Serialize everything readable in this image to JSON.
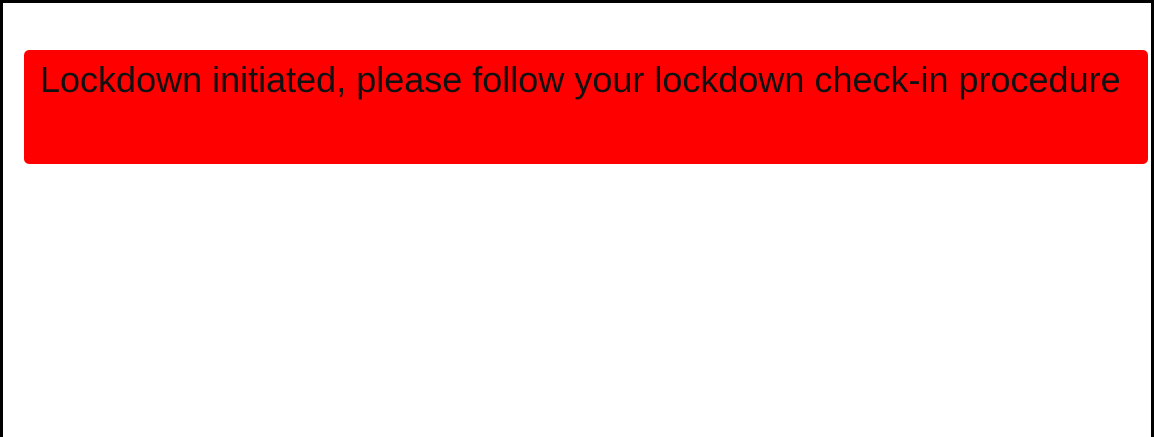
{
  "alert": {
    "message": "Lockdown initiated, please follow your lockdown check-in procedure",
    "background_color": "#ff0000",
    "text_color": "#111111"
  }
}
